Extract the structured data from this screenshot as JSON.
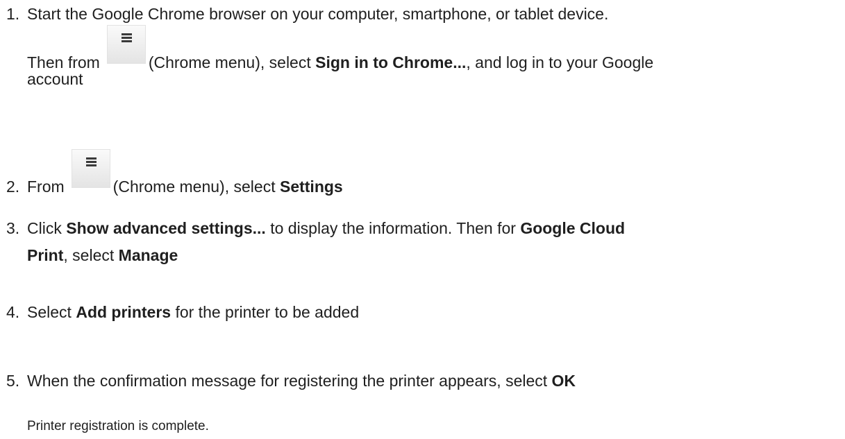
{
  "steps": [
    {
      "number": "1.",
      "line1": "Start the Google Chrome browser on your computer, smartphone, or tablet device.",
      "then_from": "Then from",
      "menu_caption": "(Chrome menu), select",
      "bold_sign_in": "Sign in to Chrome...",
      "after_sign_in": ", and log in to your Google",
      "line3": "account"
    },
    {
      "number": "2.",
      "from": "From",
      "menu_caption": "(Chrome menu), select",
      "bold_settings": "Settings"
    },
    {
      "number": "3.",
      "click": "Click",
      "bold_show_advanced": "Show advanced settings...",
      "mid": "to display the information. Then for",
      "bold_google_cloud": "Google Cloud",
      "bold_print": "Print",
      "comma_select": ", select",
      "bold_manage": "Manage"
    },
    {
      "number": "4.",
      "select": "Select",
      "bold_add_printers": "Add printers",
      "rest": "for the printer to be added"
    },
    {
      "number": "5.",
      "text": "When the confirmation message for registering the printer appears, select",
      "bold_ok": "OK"
    }
  ],
  "completion_note": "Printer registration is complete.",
  "icons": {
    "menu_icon": "hamburger-menu-icon"
  }
}
